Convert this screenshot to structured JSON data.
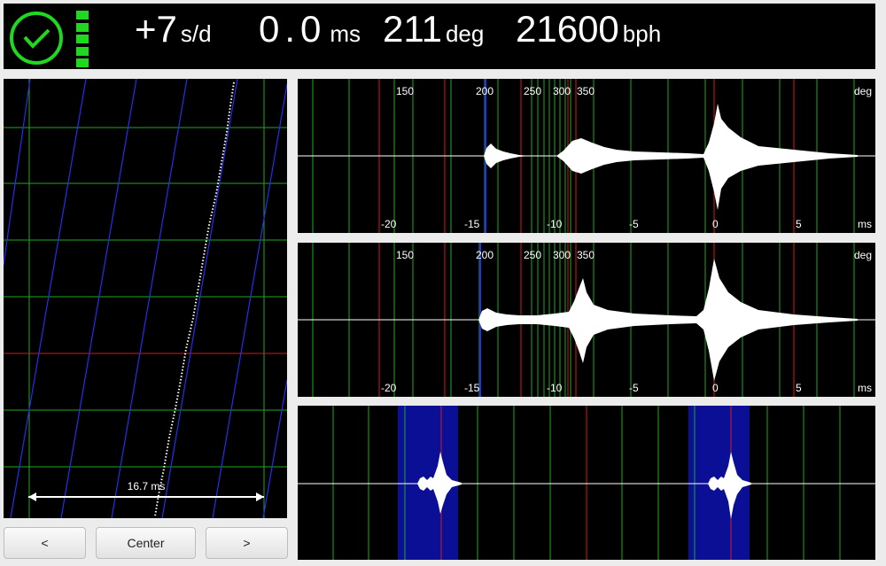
{
  "header": {
    "rate_value": "+7",
    "rate_unit": "s/d",
    "beat_error_value": "0.0",
    "beat_error_unit": "ms",
    "amplitude_value": "211",
    "amplitude_unit": "deg",
    "bph_value": "21600",
    "bph_unit": "bph",
    "status_color": "#1fd81f"
  },
  "timegrapher": {
    "span_label": "16.7 ms"
  },
  "buttons": {
    "prev_label": "<",
    "center_label": "Center",
    "next_label": ">"
  },
  "waveform_panels": [
    {
      "deg_ticks": [
        "150",
        "200",
        "250",
        "300",
        "350"
      ],
      "deg_unit": "deg",
      "ms_ticks": [
        "-20",
        "-15",
        "-10",
        "-5",
        "0",
        "5"
      ],
      "ms_unit": "ms"
    },
    {
      "deg_ticks": [
        "150",
        "200",
        "250",
        "300",
        "350"
      ],
      "deg_unit": "deg",
      "ms_ticks": [
        "-20",
        "-15",
        "-10",
        "-5",
        "0",
        "5"
      ],
      "ms_unit": "ms"
    }
  ]
}
